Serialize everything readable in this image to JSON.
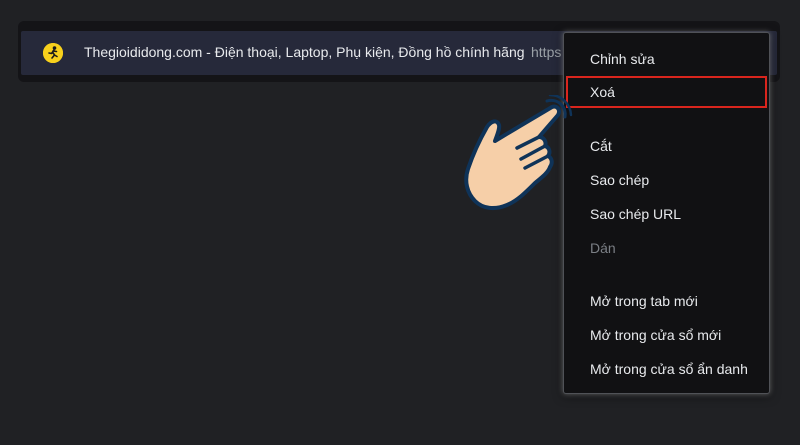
{
  "history_row": {
    "favicon": "thegioididong-favicon-icon",
    "title": "Thegioididong.com - Điện thoại, Laptop, Phụ kiện, Đồng hồ chính hãng",
    "url": "https"
  },
  "context_menu": {
    "items": [
      {
        "label": "Chỉnh sửa",
        "enabled": true
      },
      {
        "label": "Xoá",
        "enabled": true,
        "highlighted": true
      },
      {
        "label": "Cắt",
        "enabled": true
      },
      {
        "label": "Sao chép",
        "enabled": true
      },
      {
        "label": "Sao chép URL",
        "enabled": true
      },
      {
        "label": "Dán",
        "enabled": false
      },
      {
        "label": "Mở trong tab mới",
        "enabled": true
      },
      {
        "label": "Mở trong cửa sổ mới",
        "enabled": true
      },
      {
        "label": "Mở trong cửa sổ ẩn danh",
        "enabled": true
      }
    ]
  },
  "pointer": "pointing-hand-icon",
  "colors": {
    "background": "#202124",
    "row": "#26293a",
    "menu": "#111113",
    "highlight_border": "#d9251d",
    "favicon": "#f8d11c",
    "hand_skin": "#f6cfa8",
    "hand_outline": "#0f3358"
  }
}
